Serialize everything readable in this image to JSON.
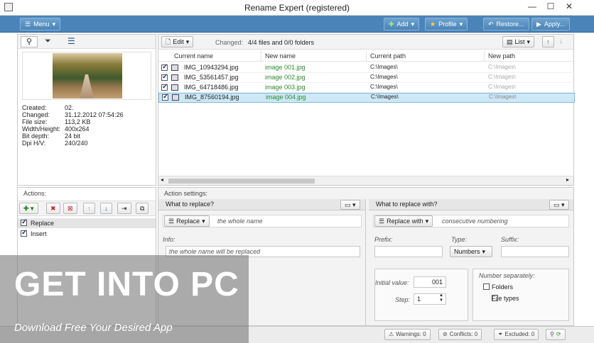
{
  "window": {
    "title": "Rename Expert (registered)",
    "minimize": "—",
    "maximize": "☐",
    "close": "✕"
  },
  "toolbar": {
    "menu": "Menu",
    "add": "Add",
    "profile": "Profile",
    "restore": "Restore...",
    "apply": "Apply..."
  },
  "info": {
    "labels": [
      "Created:",
      "Changed:",
      "File size:",
      "Width/Height:",
      "Bit depth:",
      "Dpi H/V:"
    ],
    "values": [
      "02.",
      "31.12.2012 07:54:26",
      "113,2 KB",
      "400x264",
      "24 bit",
      "240/240"
    ]
  },
  "files": {
    "edit": "Edit",
    "changed_label": "Changed:",
    "changed_value": "4/4 files and 0/0 folders",
    "view": "List",
    "columns": [
      "Current name",
      "New name",
      "Current path",
      "New path"
    ],
    "rows": [
      {
        "current": "IMG_10943294.jpg",
        "new": "image 001.jpg",
        "path": "C:\\Images\\",
        "newpath": "C:\\Images\\"
      },
      {
        "current": "IMG_53561457.jpg",
        "new": "image 002.jpg",
        "path": "C:\\Images\\",
        "newpath": "C:\\Images\\"
      },
      {
        "current": "IMG_64718486.jpg",
        "new": "image 003.jpg",
        "path": "C:\\Images\\",
        "newpath": "C:\\Images\\"
      },
      {
        "current": "IMG_87560194.jpg",
        "new": "image 004.jpg",
        "path": "C:\\Images\\",
        "newpath": "C:\\Images\\"
      }
    ]
  },
  "actions": {
    "title": "Actions:",
    "items": [
      "Replace",
      "Insert"
    ]
  },
  "settings": {
    "title": "Action settings:",
    "what_title": "What to replace?",
    "replace_btn": "Replace",
    "replace_desc": "the whole name",
    "info_label": "Info:",
    "info_value": "the whole name will be replaced",
    "with_title": "What to replace with?",
    "replace_with_btn": "Replace with",
    "with_desc": "consecutive numbering",
    "prefix_label": "Prefix:",
    "type_label": "Type:",
    "type_value": "Numbers",
    "suffix_label": "Suffix:",
    "initial_label": "Initial value:",
    "initial_value": "001",
    "step_label": "Step:",
    "step_value": "1",
    "separately_label": "Number separately:",
    "folders_label": "Folders",
    "filetypes_label": "File types"
  },
  "status": {
    "warnings": "Warnings: 0",
    "conflicts": "Conflicts: 0",
    "excluded": "Excluded: 0"
  },
  "watermark": {
    "main": "GET INTO PC",
    "sub": "Download Free Your Desired App"
  },
  "colors": {
    "accent": "#4a84b8",
    "new_name": "#2e8b2e",
    "selected_row": "#cde8f7"
  }
}
